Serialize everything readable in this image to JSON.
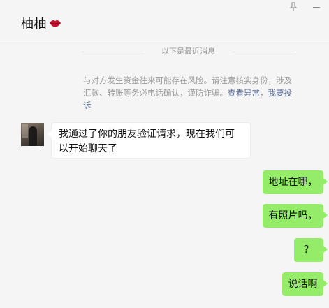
{
  "header": {
    "title": "柚柚",
    "emoji_icon": "lips-icon"
  },
  "window_controls": {
    "pin_icon": "pin-icon",
    "minimize_icon": "minimize-icon"
  },
  "separator": {
    "text": "以下是最近消息"
  },
  "warning": {
    "text": "与对方发生资金往来可能存在风险。请注意核实身份，涉及汇款、转账等务必电话确认，谨防诈骗。",
    "link_check": "查看异常",
    "separator": "，",
    "link_report": "我要投诉"
  },
  "messages": [
    {
      "direction": "incoming",
      "text": "我通过了你的朋友验证请求，现在我们可以开始聊天了"
    },
    {
      "direction": "outgoing",
      "text": "地址在哪，"
    },
    {
      "direction": "outgoing",
      "text": "有照片吗，"
    },
    {
      "direction": "outgoing",
      "text": "？"
    },
    {
      "direction": "outgoing",
      "text": "说话啊"
    }
  ],
  "colors": {
    "background": "#f5f5f5",
    "outgoing_bubble": "#95ec69",
    "incoming_bubble": "#ffffff",
    "link": "#576b95"
  }
}
